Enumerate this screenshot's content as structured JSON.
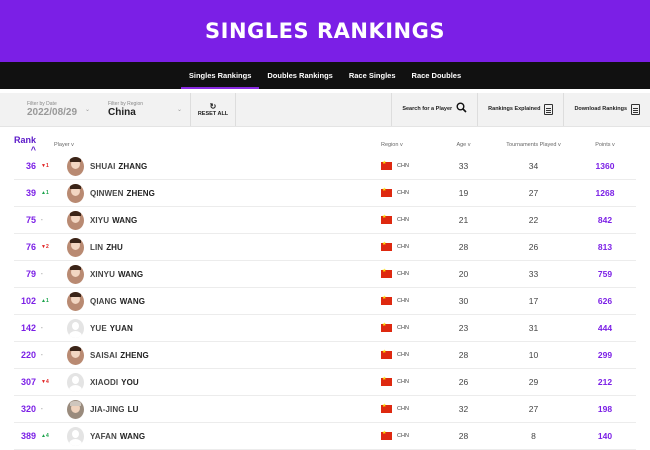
{
  "hero": {
    "title": "SINGLES RANKINGS"
  },
  "subnav": [
    "Singles Rankings",
    "Doubles Rankings",
    "Race Singles",
    "Race Doubles"
  ],
  "filters": {
    "date_label": "Filter by Date",
    "date_value": "2022/08/29",
    "region_label": "Filter by Region",
    "region_value": "China",
    "reset_label": "RESET ALL",
    "search_label": "Search for a Player",
    "explained_label": "Rankings Explained",
    "download_label": "Download Rankings"
  },
  "columns": {
    "rank": "Rank ^",
    "player": "Player v",
    "region": "Region v",
    "age": "Age v",
    "tournaments": "Tournaments Played v",
    "points": "Points v"
  },
  "rows": [
    {
      "rank": "36",
      "move": "▼1",
      "dir": "down",
      "first": "SHUAI",
      "last": "ZHANG",
      "avatar": "photo",
      "region": "CHN",
      "age": "33",
      "tournaments": "34",
      "points": "1360"
    },
    {
      "rank": "39",
      "move": "▲1",
      "dir": "up",
      "first": "QINWEN",
      "last": "ZHENG",
      "avatar": "photo",
      "region": "CHN",
      "age": "19",
      "tournaments": "27",
      "points": "1268"
    },
    {
      "rank": "75",
      "move": "-",
      "dir": "same",
      "first": "XIYU",
      "last": "WANG",
      "avatar": "photo",
      "region": "CHN",
      "age": "21",
      "tournaments": "22",
      "points": "842"
    },
    {
      "rank": "76",
      "move": "▼2",
      "dir": "down",
      "first": "LIN",
      "last": "ZHU",
      "avatar": "photo",
      "region": "CHN",
      "age": "28",
      "tournaments": "26",
      "points": "813"
    },
    {
      "rank": "79",
      "move": "-",
      "dir": "same",
      "first": "XINYU",
      "last": "WANG",
      "avatar": "photo",
      "region": "CHN",
      "age": "20",
      "tournaments": "33",
      "points": "759"
    },
    {
      "rank": "102",
      "move": "▲1",
      "dir": "up",
      "first": "QIANG",
      "last": "WANG",
      "avatar": "photo",
      "region": "CHN",
      "age": "30",
      "tournaments": "17",
      "points": "626"
    },
    {
      "rank": "142",
      "move": "-",
      "dir": "same",
      "first": "YUE",
      "last": "YUAN",
      "avatar": "ghost",
      "region": "CHN",
      "age": "23",
      "tournaments": "31",
      "points": "444"
    },
    {
      "rank": "220",
      "move": "-",
      "dir": "same",
      "first": "SAISAI",
      "last": "ZHENG",
      "avatar": "photo",
      "region": "CHN",
      "age": "28",
      "tournaments": "10",
      "points": "299"
    },
    {
      "rank": "307",
      "move": "▼4",
      "dir": "down",
      "first": "XIAODI",
      "last": "YOU",
      "avatar": "ghost",
      "region": "CHN",
      "age": "26",
      "tournaments": "29",
      "points": "212"
    },
    {
      "rank": "320",
      "move": "-",
      "dir": "same",
      "first": "JIA-JING",
      "last": "LU",
      "avatar": "grey",
      "region": "CHN",
      "age": "32",
      "tournaments": "27",
      "points": "198"
    },
    {
      "rank": "389",
      "move": "▲4",
      "dir": "up",
      "first": "YAFAN",
      "last": "WANG",
      "avatar": "ghost",
      "region": "CHN",
      "age": "28",
      "tournaments": "8",
      "points": "140"
    }
  ]
}
